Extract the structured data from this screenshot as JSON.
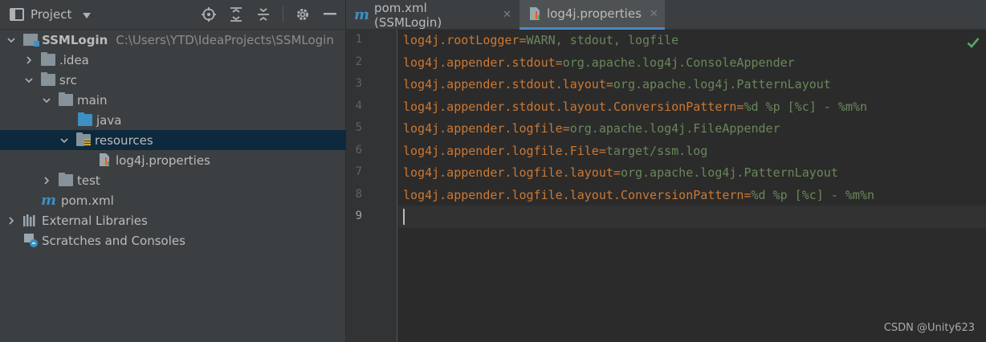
{
  "project_panel": {
    "title": "Project",
    "tree": [
      {
        "label": "SSMLogin",
        "hint": "C:\\Users\\YTD\\IdeaProjects\\SSMLogin"
      },
      {
        "label": ".idea"
      },
      {
        "label": "src"
      },
      {
        "label": "main"
      },
      {
        "label": "java"
      },
      {
        "label": "resources"
      },
      {
        "label": "log4j.properties"
      },
      {
        "label": "test"
      },
      {
        "label": "pom.xml"
      },
      {
        "label": "External Libraries"
      },
      {
        "label": "Scratches and Consoles"
      }
    ]
  },
  "tabs": [
    {
      "label": "pom.xml (SSMLogin)",
      "icon": "maven-m-icon"
    },
    {
      "label": "log4j.properties",
      "icon": "properties-file-icon",
      "active": true
    }
  ],
  "editor": {
    "line_numbers": [
      "1",
      "2",
      "3",
      "4",
      "5",
      "6",
      "7",
      "8",
      "9"
    ],
    "lines": [
      {
        "key": "log4j.rootLogger",
        "value": "WARN, stdout, logfile"
      },
      {
        "key": "log4j.appender.stdout",
        "value": "org.apache.log4j.ConsoleAppender"
      },
      {
        "key": "log4j.appender.stdout.layout",
        "value": "org.apache.log4j.PatternLayout"
      },
      {
        "key": "log4j.appender.stdout.layout.ConversionPattern",
        "value": "%d %p [%c] - %m%n"
      },
      {
        "key": "log4j.appender.logfile",
        "value": "org.apache.log4j.FileAppender"
      },
      {
        "key": "log4j.appender.logfile.File",
        "value": "target/ssm.log"
      },
      {
        "key": "log4j.appender.logfile.layout",
        "value": "org.apache.log4j.PatternLayout"
      },
      {
        "key": "log4j.appender.logfile.layout.ConversionPattern",
        "value": "%d %p [%c] - %m%n"
      }
    ],
    "separator": "="
  },
  "watermark": "CSDN @Unity623",
  "colors": {
    "key": "#cc7832",
    "value": "#6a8759",
    "selection": "#0d293e",
    "accent": "#4a88c7",
    "check": "#59a869"
  }
}
